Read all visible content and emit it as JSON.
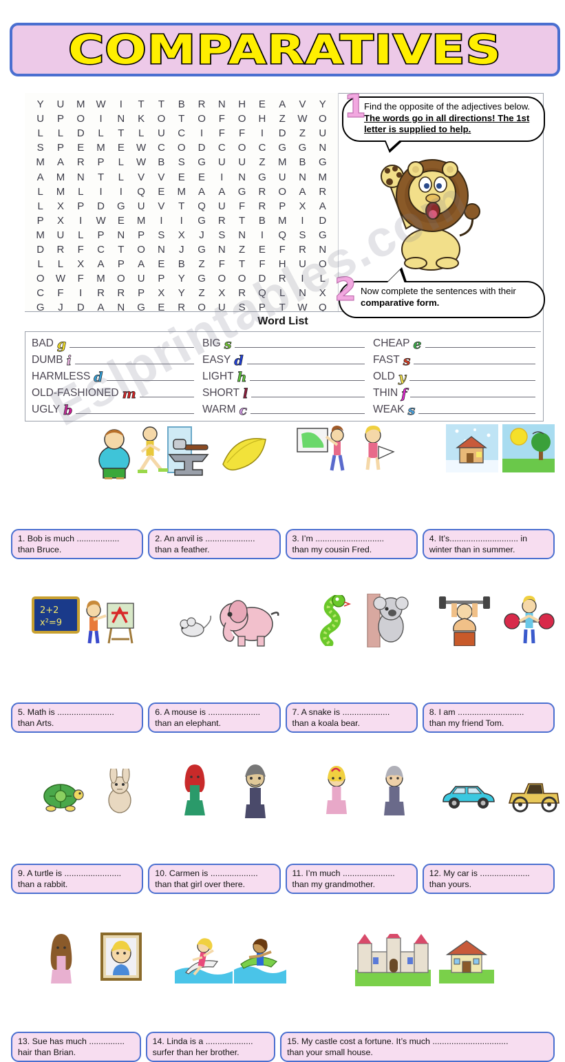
{
  "title": "COMPARATIVES",
  "instructions": {
    "one": {
      "number": "1",
      "normal": "Find the opposite of the adjectives below. ",
      "emphasis": "The words go in all directions! The 1st letter is supplied to help."
    },
    "two": {
      "number": "2",
      "normal": "Now complete the sentences with their ",
      "emphasis": "comparative form."
    }
  },
  "word_search": {
    "grid": [
      [
        "Y",
        "U",
        "M",
        "W",
        "I",
        "T",
        "T",
        "B",
        "R",
        "N",
        "H",
        "E",
        "A",
        "V",
        "Y"
      ],
      [
        "U",
        "P",
        "O",
        "I",
        "N",
        "K",
        "O",
        "T",
        "O",
        "F",
        "O",
        "H",
        "Z",
        "W",
        "O"
      ],
      [
        "L",
        "L",
        "D",
        "L",
        "T",
        "L",
        "U",
        "C",
        "I",
        "F",
        "F",
        "I",
        "D",
        "Z",
        "U"
      ],
      [
        "S",
        "P",
        "E",
        "M",
        "E",
        "W",
        "C",
        "O",
        "D",
        "C",
        "O",
        "C",
        "G",
        "G",
        "N"
      ],
      [
        "M",
        "A",
        "R",
        "P",
        "L",
        "W",
        "B",
        "S",
        "G",
        "U",
        "U",
        "Z",
        "M",
        "B",
        "G"
      ],
      [
        "A",
        "M",
        "N",
        "T",
        "L",
        "V",
        "V",
        "E",
        "E",
        "I",
        "N",
        "G",
        "U",
        "N",
        "M"
      ],
      [
        "L",
        "M",
        "L",
        "I",
        "I",
        "Q",
        "E",
        "M",
        "A",
        "A",
        "G",
        "R",
        "O",
        "A",
        "R"
      ],
      [
        "L",
        "X",
        "P",
        "D",
        "G",
        "U",
        "V",
        "T",
        "Q",
        "U",
        "F",
        "R",
        "P",
        "X",
        "A"
      ],
      [
        "P",
        "X",
        "I",
        "W",
        "E",
        "M",
        "I",
        "I",
        "G",
        "R",
        "T",
        "B",
        "M",
        "I",
        "D"
      ],
      [
        "M",
        "U",
        "L",
        "P",
        "N",
        "P",
        "S",
        "X",
        "J",
        "S",
        "N",
        "I",
        "Q",
        "S",
        "G"
      ],
      [
        "D",
        "R",
        "F",
        "C",
        "T",
        "O",
        "N",
        "J",
        "G",
        "N",
        "Z",
        "E",
        "F",
        "R",
        "N"
      ],
      [
        "L",
        "L",
        "X",
        "A",
        "P",
        "A",
        "E",
        "B",
        "Z",
        "F",
        "T",
        "F",
        "H",
        "U",
        "O"
      ],
      [
        "O",
        "W",
        "F",
        "M",
        "O",
        "U",
        "P",
        "Y",
        "G",
        "O",
        "O",
        "D",
        "R",
        "I",
        "L"
      ],
      [
        "C",
        "F",
        "I",
        "R",
        "R",
        "P",
        "X",
        "Y",
        "Z",
        "X",
        "R",
        "Q",
        "L",
        "N",
        "X"
      ],
      [
        "G",
        "J",
        "D",
        "A",
        "N",
        "G",
        "E",
        "R",
        "O",
        "U",
        "S",
        "P",
        "T",
        "W",
        "Q"
      ]
    ]
  },
  "word_list": {
    "header": "Word List",
    "columns": [
      [
        {
          "word": "BAD",
          "hint": "g",
          "hint_color": "#f5e02a"
        },
        {
          "word": "DUMB",
          "hint": "i",
          "hint_color": "#f0b8e8"
        },
        {
          "word": "HARMLESS",
          "hint": "d",
          "hint_color": "#2f9fd8"
        },
        {
          "word": "OLD-FASHIONED",
          "hint": "m",
          "hint_color": "#d42020"
        },
        {
          "word": "UGLY",
          "hint": "b",
          "hint_color": "#d4189a"
        }
      ],
      [
        {
          "word": "BIG",
          "hint": "s",
          "hint_color": "#6ec62e"
        },
        {
          "word": "EASY",
          "hint": "d",
          "hint_color": "#2040d8"
        },
        {
          "word": "LIGHT",
          "hint": "h",
          "hint_color": "#5ec23a"
        },
        {
          "word": "SHORT",
          "hint": "l",
          "hint_color": "#8c1c3c"
        },
        {
          "word": "WARM",
          "hint": "c",
          "hint_color": "#d49ae8"
        }
      ],
      [
        {
          "word": "CHEAP",
          "hint": "e",
          "hint_color": "#3cb44a"
        },
        {
          "word": "FAST",
          "hint": "s",
          "hint_color": "#d43a20"
        },
        {
          "word": "OLD",
          "hint": "y",
          "hint_color": "#f5e24a"
        },
        {
          "word": "THIN",
          "hint": "f",
          "hint_color": "#e02ad0"
        },
        {
          "word": "WEAK",
          "hint": "s",
          "hint_color": "#4aa8e8"
        }
      ]
    ]
  },
  "exercises": [
    {
      "n": "1.",
      "line1": "1. Bob is much ..................",
      "line2": "than Bruce."
    },
    {
      "n": "2.",
      "line1": "2. An anvil is .....................",
      "line2": "than a feather."
    },
    {
      "n": "3.",
      "line1": "3. I’m  .............................",
      "line2": "than my cousin Fred."
    },
    {
      "n": "4.",
      "line1": "4. It’s............................. in",
      "line2": "winter than in summer."
    },
    {
      "n": "5.",
      "line1": "5. Math is ........................",
      "line2": "than Arts."
    },
    {
      "n": "6.",
      "line1": "6. A mouse is ......................",
      "line2": "than an elephant."
    },
    {
      "n": "7.",
      "line1": "7. A snake is ....................",
      "line2": "than a koala bear."
    },
    {
      "n": "8.",
      "line1": "8. I am ............................",
      "line2": "than my friend Tom."
    },
    {
      "n": "9.",
      "line1": "9. A turtle is ........................",
      "line2": "than a rabbit."
    },
    {
      "n": "10.",
      "line1": "10. Carmen is ....................",
      "line2": "than that girl over there."
    },
    {
      "n": "11.",
      "line1": "11. I’m much ......................",
      "line2": "than my grandmother."
    },
    {
      "n": "12.",
      "line1": "12. My car is .....................",
      "line2": "than yours."
    },
    {
      "n": "13.",
      "line1": "13. Sue has much ...............",
      "line2": "hair than Brian."
    },
    {
      "n": "14.",
      "line1": "14. Linda is a ....................",
      "line2": "surfer than her brother."
    },
    {
      "n": "15.",
      "line1": "15. My castle cost a fortune. It’s much ................................",
      "line2": "than your small house."
    }
  ],
  "watermark": "Eslprintables.com",
  "colors": {
    "banner_bg": "#edc9e8",
    "banner_border": "#4a6fd0",
    "title_fill": "#ffef00",
    "sentence_bg": "#f7ddf0",
    "sentence_border": "#4a6fd0"
  },
  "illustrations": [
    {
      "name": "fat-man"
    },
    {
      "name": "thin-man-mirror"
    },
    {
      "name": "anvil-hammer"
    },
    {
      "name": "feather"
    },
    {
      "name": "girl-pointing-map"
    },
    {
      "name": "boy-reading"
    },
    {
      "name": "winter-house-snow"
    },
    {
      "name": "summer-sun-tree"
    },
    {
      "name": "math-chalkboard"
    },
    {
      "name": "boy-painting-easel"
    },
    {
      "name": "mouse"
    },
    {
      "name": "elephant"
    },
    {
      "name": "snake"
    },
    {
      "name": "koala-on-tree"
    },
    {
      "name": "strong-man-weights"
    },
    {
      "name": "weak-man-weights"
    },
    {
      "name": "turtle"
    },
    {
      "name": "rabbit"
    },
    {
      "name": "pretty-woman"
    },
    {
      "name": "ugly-woman"
    },
    {
      "name": "young-girl"
    },
    {
      "name": "older-woman"
    },
    {
      "name": "modern-car"
    },
    {
      "name": "old-fashioned-car"
    },
    {
      "name": "girl-long-hair"
    },
    {
      "name": "boy-short-hair-portrait"
    },
    {
      "name": "girl-surfer"
    },
    {
      "name": "boy-surfer"
    },
    {
      "name": "castle"
    },
    {
      "name": "small-house"
    }
  ]
}
